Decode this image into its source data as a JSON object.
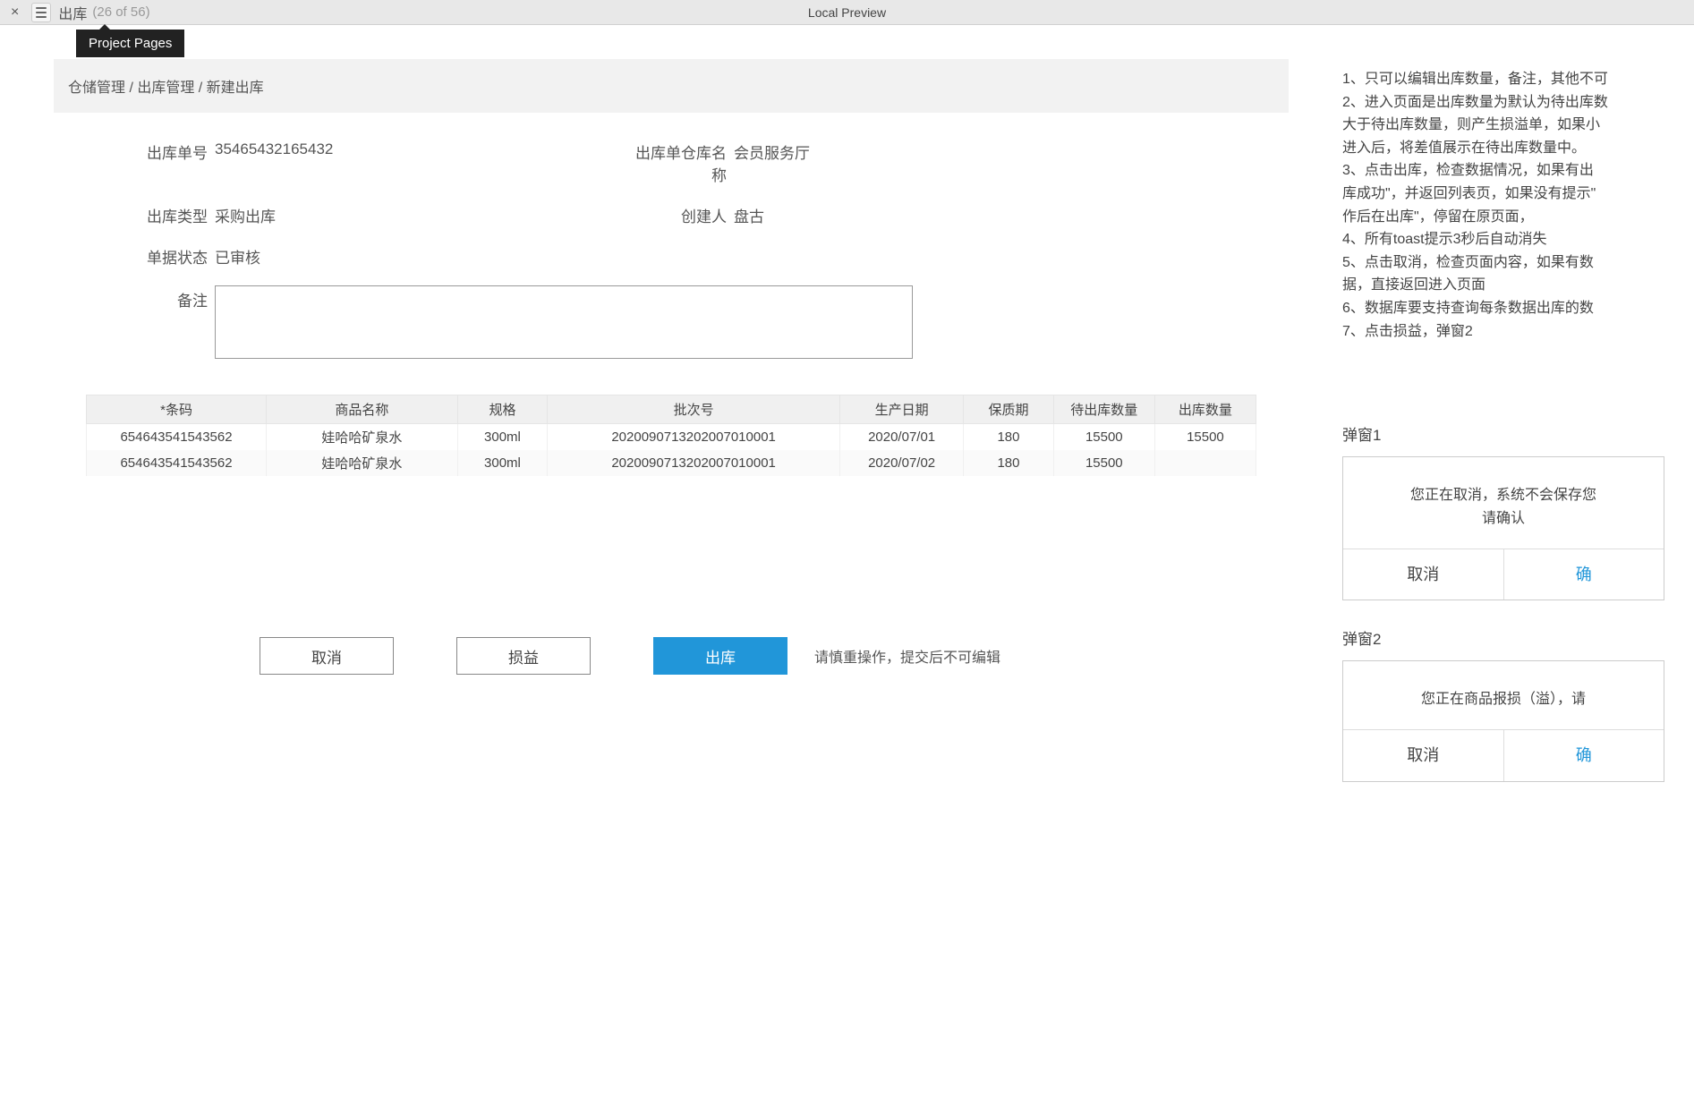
{
  "topbar": {
    "page_title": "出库",
    "page_counter": "(26 of 56)",
    "center_label": "Local Preview",
    "project_pages_tooltip": "Project Pages"
  },
  "breadcrumb": "仓储管理 / 出库管理 / 新建出库",
  "fields": {
    "order_no": {
      "label": "出库单号",
      "value": "35465432165432"
    },
    "warehouse": {
      "label": "出库单仓库名称",
      "value": "会员服务厅"
    },
    "out_type": {
      "label": "出库类型",
      "value": "采购出库"
    },
    "creator": {
      "label": "创建人",
      "value": "盘古"
    },
    "status": {
      "label": "单据状态",
      "value": "已审核"
    },
    "remark": {
      "label": "备注",
      "value": ""
    }
  },
  "table": {
    "headers": [
      "*条码",
      "商品名称",
      "规格",
      "批次号",
      "生产日期",
      "保质期",
      "待出库数量",
      "出库数量"
    ],
    "rows": [
      {
        "barcode": "654643541543562",
        "name": "娃哈哈矿泉水",
        "spec": "300ml",
        "batch": "202009071320200701​0001",
        "produce_date": "2020/07/01",
        "shelf": "180",
        "pending": "15500",
        "out_qty": "15500"
      },
      {
        "barcode": "654643541543562",
        "name": "娃哈哈矿泉水",
        "spec": "300ml",
        "batch": "202009071320200701​0001",
        "produce_date": "2020/07/02",
        "shelf": "180",
        "pending": "15500",
        "out_qty": ""
      }
    ]
  },
  "actions": {
    "cancel": "取消",
    "loss_gain": "损益",
    "outbound": "出库",
    "hint": "请慎重操作，提交后不可编辑"
  },
  "notes": [
    "1、只可以编辑出库数量，备注，其他不可",
    "2、进入页面是出库数量为默认为待出库数",
    "大于待出库数量，则产生损溢单，如果小",
    "进入后，将差值展示在待出库数量中。",
    "3、点击出库，检查数据情况，如果有出",
    "库成功\"，并返回列表页，如果没有提示\"",
    "作后在出库\"，停留在原页面，",
    "4、所有toast提示3秒后自动消失",
    "5、点击取消，检查页面内容，如果有数",
    "据，直接返回进入页面",
    "6、数据库要支持查询每条数据出库的数",
    "7、点击损益，弹窗2"
  ],
  "dialog1": {
    "title": "弹窗1",
    "line1": "您正在取消，系统不会保存您",
    "line2": "请确认",
    "cancel": "取消",
    "confirm": "确"
  },
  "dialog2": {
    "title": "弹窗2",
    "line1": "您正在商品报损（溢），请",
    "cancel": "取消",
    "confirm": "确"
  }
}
